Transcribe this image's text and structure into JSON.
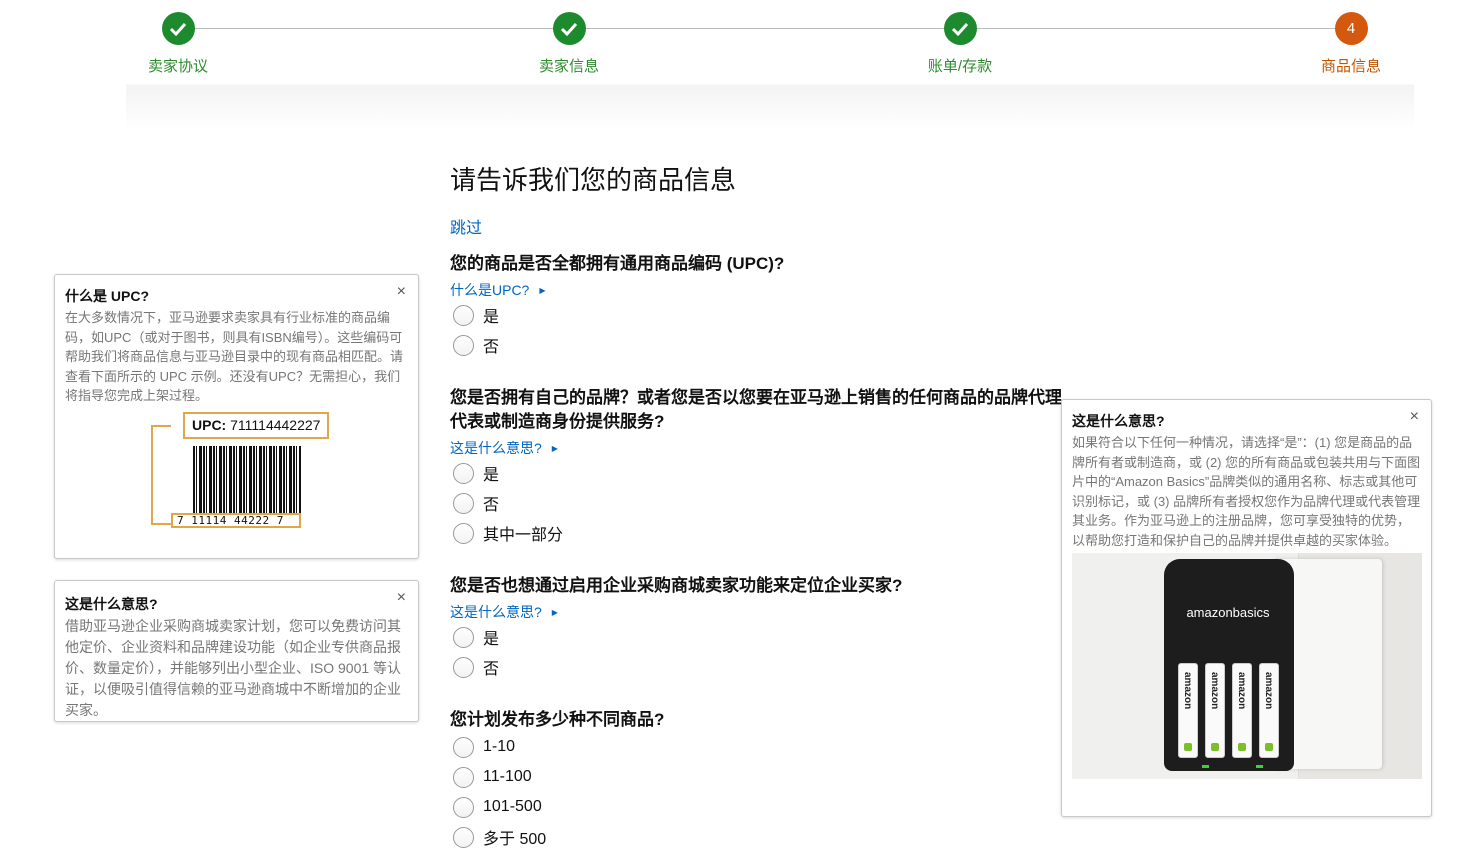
{
  "stepper": {
    "steps": [
      {
        "label": "卖家协议",
        "status": "done",
        "icon": "check-icon"
      },
      {
        "label": "卖家信息",
        "status": "done",
        "icon": "check-icon"
      },
      {
        "label": "账单/存款",
        "status": "done",
        "icon": "check-icon"
      },
      {
        "label": "商品信息",
        "status": "current",
        "number": "4"
      }
    ],
    "colors": {
      "done": "#1e8a2e",
      "current": "#d4580e"
    }
  },
  "main": {
    "title": "请告诉我们您的商品信息",
    "skip_label": "跳过",
    "questions": [
      {
        "title": "您的商品是否全都拥有通用商品编码 (UPC)?",
        "help_label": "什么是UPC?",
        "options": [
          "是",
          "否"
        ]
      },
      {
        "title": "您是否拥有自己的品牌？或者您是否以您要在亚马逊上销售的任何商品的品牌代理、代表或制造商身份提供服务?",
        "help_label": "这是什么意思?",
        "options": [
          "是",
          "否",
          "其中一部分"
        ]
      },
      {
        "title": "您是否也想通过启用企业采购商城卖家功能来定位企业买家?",
        "help_label": "这是什么意思?",
        "options": [
          "是",
          "否"
        ]
      },
      {
        "title": "您计划发布多少种不同商品?",
        "options": [
          "1-10",
          "11-100",
          "101-500",
          "多于 500"
        ]
      }
    ]
  },
  "popovers": {
    "upc": {
      "title": "什么是 UPC?",
      "body": "在大多数情况下，亚马逊要求卖家具有行业标准的商品编码，如UPC（或对于图书，则具有ISBN编号）。这些编码可帮助我们将商品信息与亚马逊目录中的现有商品相匹配。请查看下面所示的 UPC 示例。还没有UPC？无需担心，我们将指导您完成上架过程。",
      "close": "×",
      "figure": {
        "label_prefix": "UPC:",
        "label_value": "711114442227",
        "digits": "7 11114 44222 7"
      }
    },
    "business": {
      "title": "这是什么意思?",
      "body": "借助亚马逊企业采购商城卖家计划，您可以免费访问其他定价、企业资料和品牌建设功能（如企业专供商品报价、数量定价），并能够列出小型企业、ISO 9001 等认证，以便吸引值得信赖的亚马逊商城中不断增加的企业买家。",
      "close": "×"
    },
    "brand": {
      "title": "这是什么意思?",
      "body": "如果符合以下任何一种情况，请选择“是”：(1) 您是商品的品牌所有者或制造商，或 (2) 您的所有商品或包装共用与下面图片中的“Amazon Basics”品牌类似的通用名称、标志或其他可识别标记，或 (3) 品牌所有者授权您作为品牌代理或代表管理其业务。作为亚马逊上的注册品牌，您可享受独特的优势，以帮助您打造和保护自己的品牌并提供卓越的买家体验。",
      "close": "×",
      "photo": {
        "brand_text": "amazonbasics",
        "battery_text": "amazon"
      }
    }
  }
}
